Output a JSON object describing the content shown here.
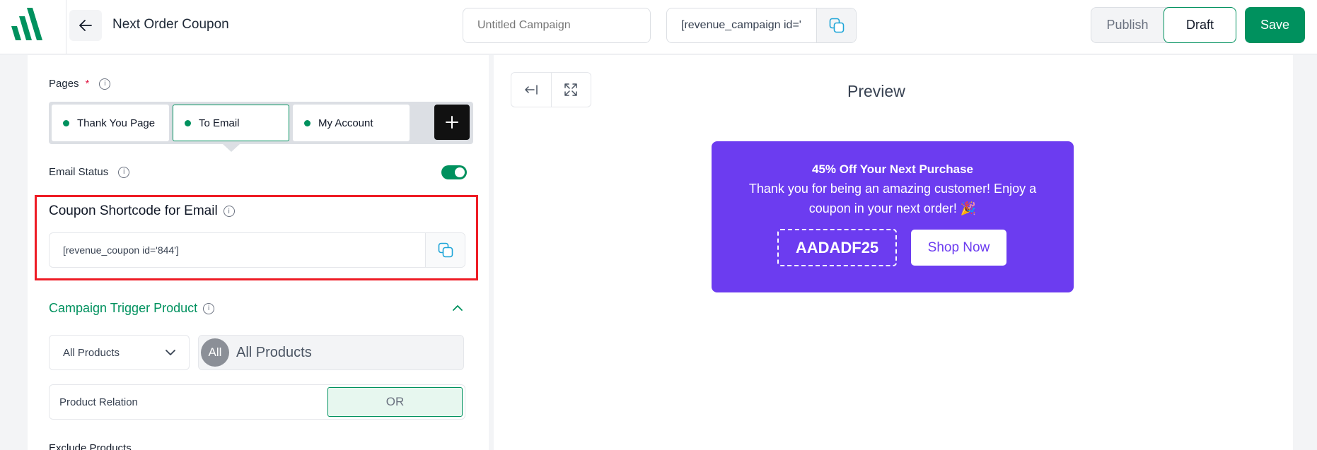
{
  "header": {
    "title": "Next Order Coupon",
    "campaign_name_placeholder": "Untitled Campaign",
    "campaign_shortcode": "[revenue_campaign id='",
    "publish_label": "Publish",
    "draft_label": "Draft",
    "save_label": "Save"
  },
  "pages": {
    "label": "Pages",
    "required_mark": "*",
    "tabs": [
      {
        "label": "Thank You Page"
      },
      {
        "label": "To Email"
      },
      {
        "label": "My Account"
      }
    ],
    "active_tab": "To Email"
  },
  "email_status": {
    "label": "Email Status",
    "enabled": true
  },
  "coupon_shortcode": {
    "title": "Coupon Shortcode for Email",
    "value": "[revenue_coupon id='844']"
  },
  "trigger": {
    "title": "Campaign Trigger Product",
    "select_value": "All Products",
    "chip_avatar": "All",
    "chip_label": "All Products",
    "relation_label": "Product Relation",
    "relation_value": "OR",
    "exclude_label": "Exclude Products"
  },
  "preview": {
    "title": "Preview",
    "promo_heading": "45% Off Your Next Purchase",
    "promo_body": "Thank you for being an amazing customer! Enjoy a coupon in your next order! 🎉",
    "coupon_code": "AADADF25",
    "button_label": "Shop Now"
  },
  "colors": {
    "brand_green": "#00915e",
    "promo_purple": "#6c3cf0",
    "highlight_red": "#ee1c25"
  },
  "icons": {
    "logo": "brand-logo",
    "back": "arrow-left-icon",
    "copy": "copy-icon",
    "info": "info-icon",
    "add": "plus-icon",
    "collapse": "chevron-up-icon",
    "dropdown": "chevron-down-icon",
    "sidebar_toggle": "collapse-left-icon",
    "fullscreen": "expand-icon"
  }
}
